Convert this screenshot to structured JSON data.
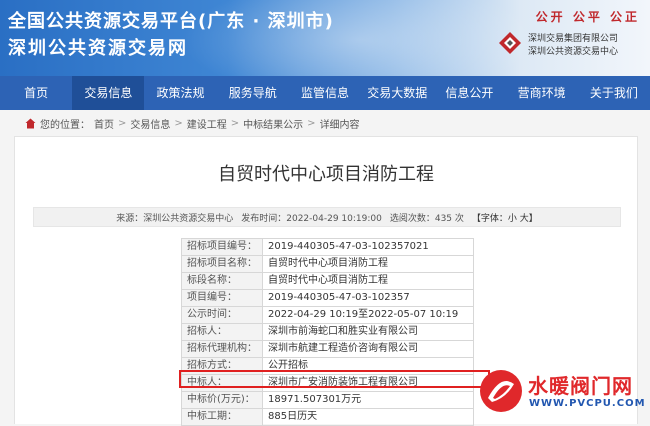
{
  "header": {
    "title_line1": "全国公共资源交易平台(广东 · 深圳市)",
    "title_line2": "深圳公共资源交易网",
    "slogan": "公开 公平 公正",
    "org_line1": "深圳交易集团有限公司",
    "org_line2": "深圳公共资源交易中心"
  },
  "nav": {
    "items": [
      "首页",
      "交易信息",
      "政策法规",
      "服务导航",
      "监管信息",
      "交易大数据",
      "信息公开",
      "营商环境",
      "关于我们"
    ],
    "active_index": 1
  },
  "breadcrumb": {
    "prefix": "您的位置：",
    "items": [
      "首页",
      "交易信息",
      "建设工程",
      "中标结果公示",
      "详细内容"
    ]
  },
  "article": {
    "title": "自贸时代中心项目消防工程",
    "source": "来源：深圳公共资源交易中心",
    "publish_time": "发布时间：2022-04-29 10:19:00",
    "view_count": "选阅次数：435 次",
    "font_size_label": "【字体：小 大】"
  },
  "details": [
    {
      "label": "招标项目编号：",
      "value": "2019-440305-47-03-102357021"
    },
    {
      "label": "招标项目名称：",
      "value": "自贸时代中心项目消防工程"
    },
    {
      "label": "标段名称：",
      "value": "自贸时代中心项目消防工程"
    },
    {
      "label": "项目编号：",
      "value": "2019-440305-47-03-102357"
    },
    {
      "label": "公示时间：",
      "value": "2022-04-29 10:19至2022-05-07 10:19"
    },
    {
      "label": "招标人：",
      "value": "深圳市前海蛇口和胜实业有限公司"
    },
    {
      "label": "招标代理机构：",
      "value": "深圳市航建工程造价咨询有限公司"
    },
    {
      "label": "招标方式：",
      "value": "公开招标"
    },
    {
      "label": "中标人：",
      "value": "深圳市广安消防装饰工程有限公司"
    },
    {
      "label": "中标价(万元)：",
      "value": "18971.507301万元"
    },
    {
      "label": "中标工期：",
      "value": "885日历天"
    }
  ],
  "watermark": {
    "brand": "水暖阀门网",
    "url": "WWW.PVCPU.COM"
  },
  "colors": {
    "nav_bg": "#2d63b5",
    "nav_active": "#1f4f98",
    "slogan_red": "#c0282c",
    "highlight_red": "#e02020"
  }
}
